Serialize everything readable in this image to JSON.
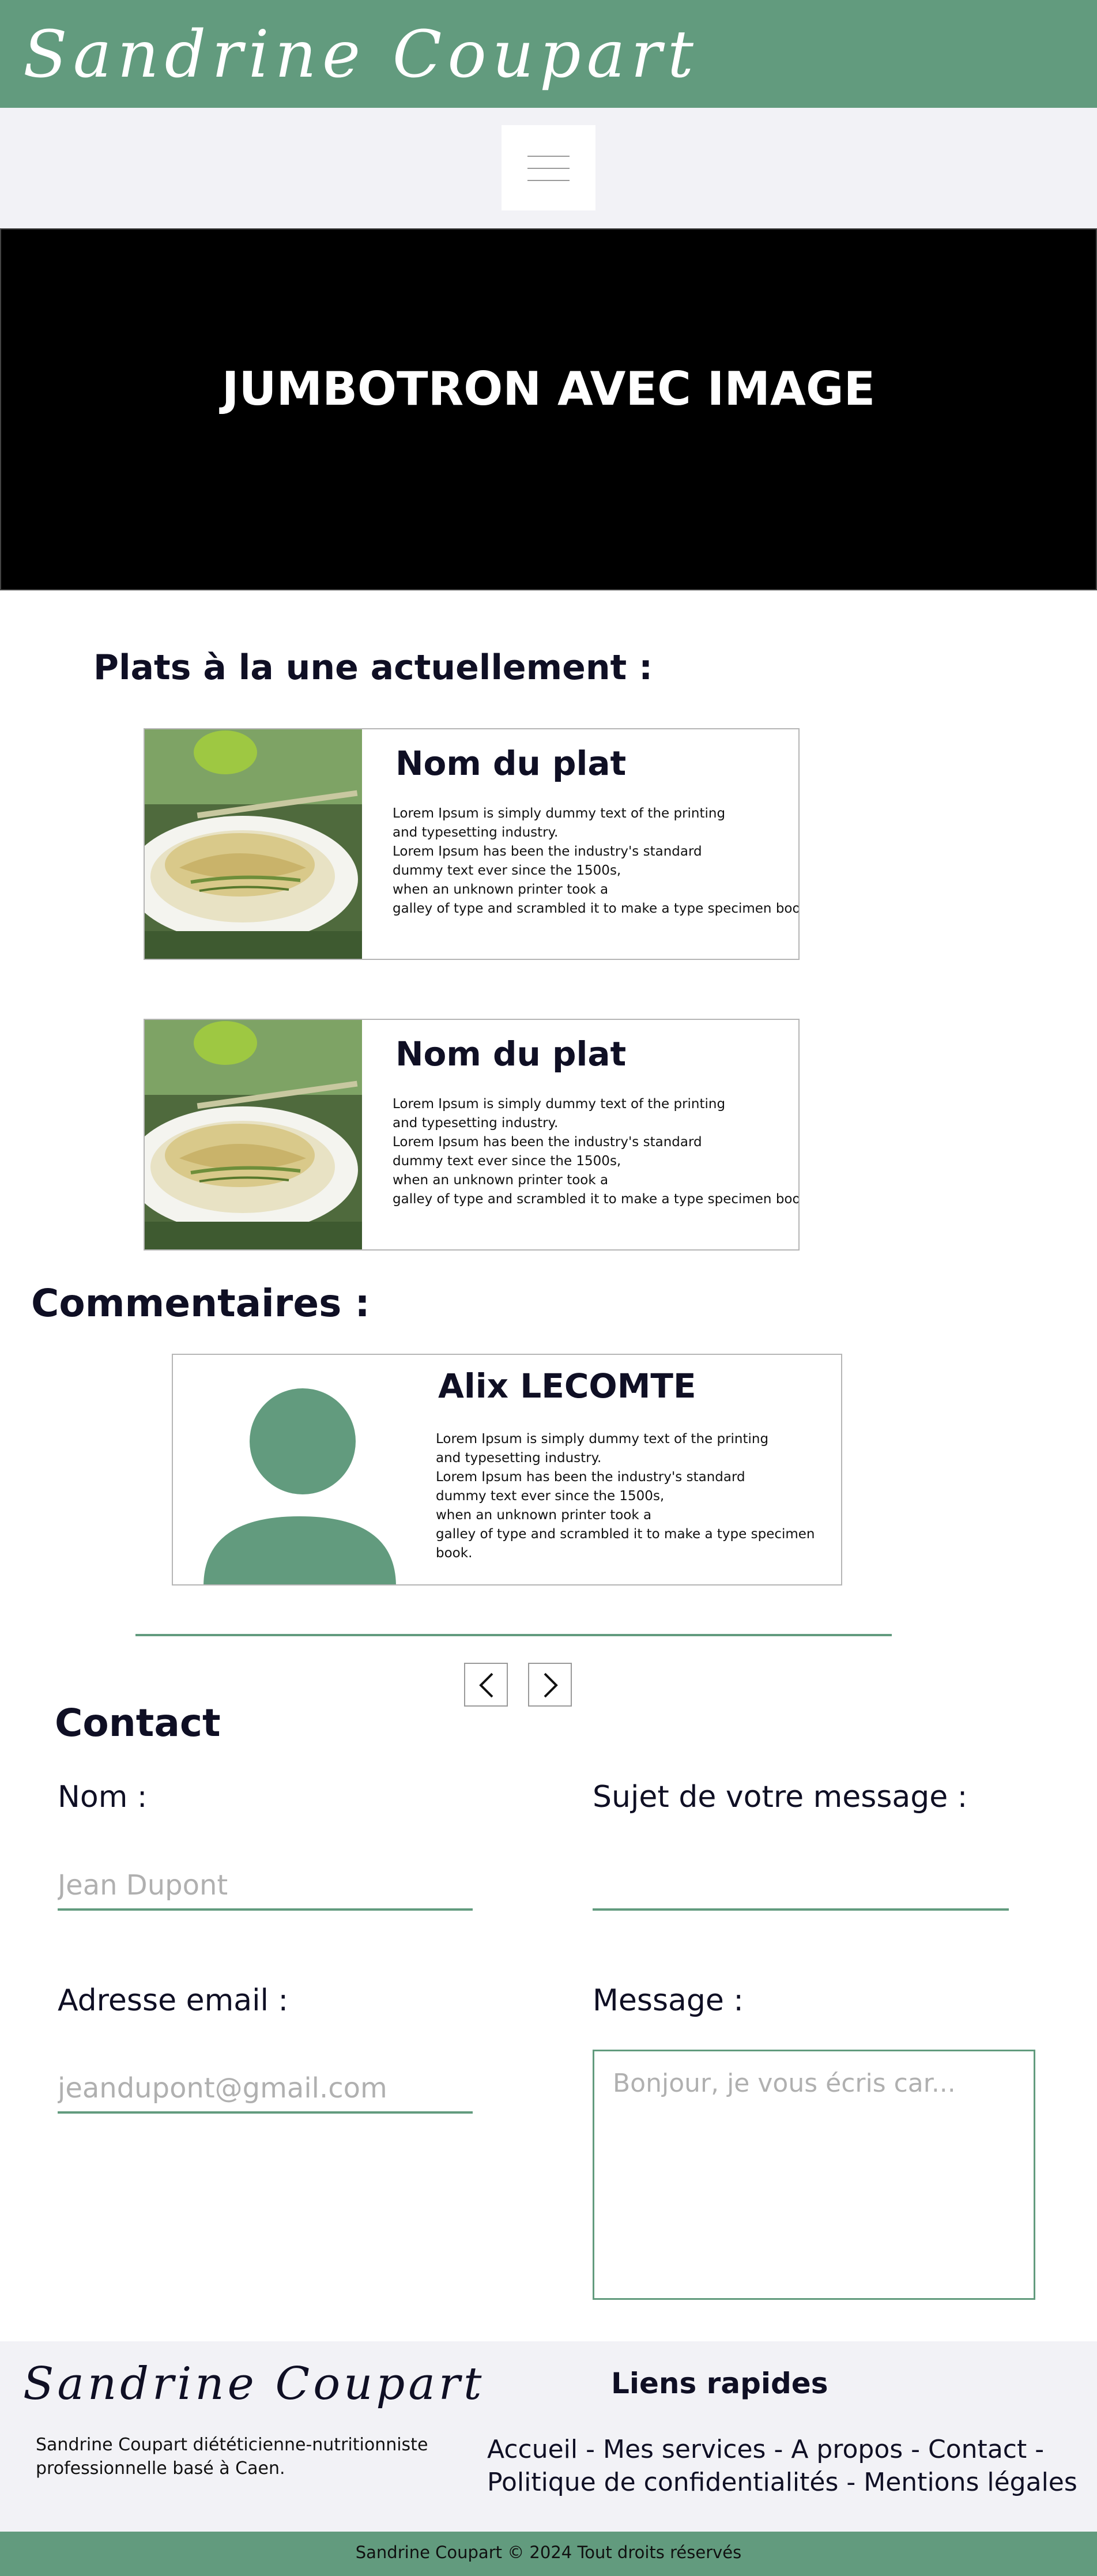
{
  "header": {
    "brand": "Sandrine Coupart"
  },
  "nav": {
    "menu_icon": "hamburger-menu-icon"
  },
  "jumbotron": {
    "title": "JUMBOTRON AVEC IMAGE"
  },
  "plats": {
    "title": "Plats à la une actuellement :",
    "items": [
      {
        "name": "Nom du plat",
        "text": "Lorem Ipsum is simply dummy text of the printing\nand typesetting industry.\nLorem Ipsum has been the industry's standard\n dummy text ever since the 1500s,\nwhen an unknown printer took a\ngalley of type and scrambled it to make a type specimen book."
      },
      {
        "name": "Nom du plat",
        "text": "Lorem Ipsum is simply dummy text of the printing\nand typesetting industry.\nLorem Ipsum has been the industry's standard\n dummy text ever since the 1500s,\nwhen an unknown printer took a\ngalley of type and scrambled it to make a type specimen book."
      }
    ]
  },
  "comments": {
    "title": "Commentaires :",
    "items": [
      {
        "author": "Alix LECOMTE",
        "text": "Lorem Ipsum is simply dummy text of the printing\nand typesetting industry.\nLorem Ipsum has been the industry's standard\n dummy text ever since the 1500s,\nwhen an unknown printer took a\ngalley of type and scrambled it to make a type specimen book."
      }
    ]
  },
  "contact": {
    "title": "Contact",
    "name_label": "Nom :",
    "name_placeholder": "Jean Dupont",
    "subject_label": "Sujet de votre message :",
    "subject_placeholder": "",
    "email_label": "Adresse email :",
    "email_placeholder": "jeandupont@gmail.com",
    "message_label": "Message :",
    "message_placeholder": "Bonjour, je vous écris car..."
  },
  "footer": {
    "brand": "Sandrine Coupart",
    "description": "Sandrine Coupart diététicienne-nutritionniste professionnelle basé à Caen.",
    "links_title": "Liens rapides",
    "links": [
      "Accueil",
      "Mes services",
      "A propos",
      "Contact",
      "Politique de confidentialités",
      "Mentions légales"
    ],
    "copyright": "Sandrine Coupart © 2024 Tout droits réservés"
  },
  "colors": {
    "accent": "#629b7e",
    "dark_text": "#0f0f24",
    "light_bg": "#f2f2f6"
  }
}
